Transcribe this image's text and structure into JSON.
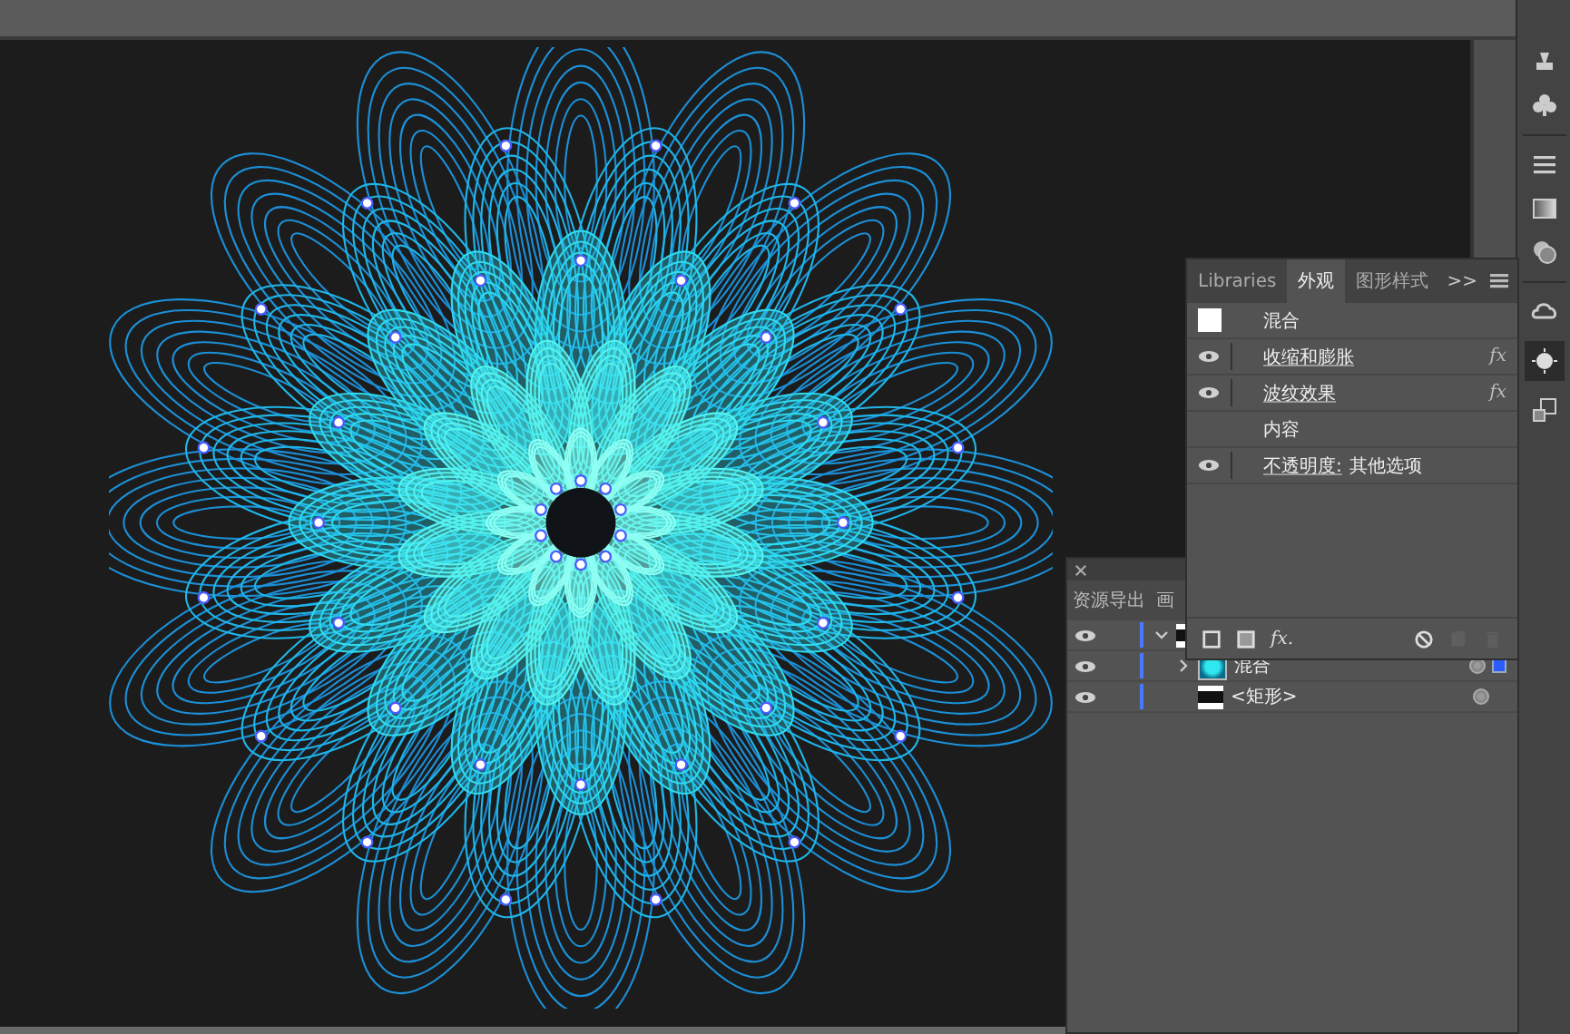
{
  "appearance_panel": {
    "tabs": [
      {
        "label": "Libraries",
        "selected": false
      },
      {
        "label": "外观",
        "selected": true
      },
      {
        "label": "图形样式",
        "selected": false
      }
    ],
    "overflow": ">>",
    "object": "混合",
    "rows": [
      {
        "kind": "effect",
        "label": "收缩和膨胀",
        "visible": true,
        "fx": "fx"
      },
      {
        "kind": "effect",
        "label": "波纹效果",
        "visible": true,
        "fx": "fx"
      },
      {
        "kind": "content",
        "label": "内容"
      },
      {
        "kind": "attribute",
        "label": "不透明度:",
        "value": "其他选项",
        "visible": true
      }
    ],
    "footer_fx": "fx."
  },
  "layers_panel": {
    "tabs": [
      {
        "label": "资源导出",
        "selected": false
      },
      {
        "label": "画",
        "selected": false
      }
    ],
    "layers": [
      {
        "visible": true,
        "expanded": true,
        "children": [
          {
            "label": "混合",
            "visible": true,
            "expanded": false,
            "selected": true
          },
          {
            "label": "<矩形>",
            "visible": true,
            "selected": false
          }
        ]
      }
    ]
  }
}
